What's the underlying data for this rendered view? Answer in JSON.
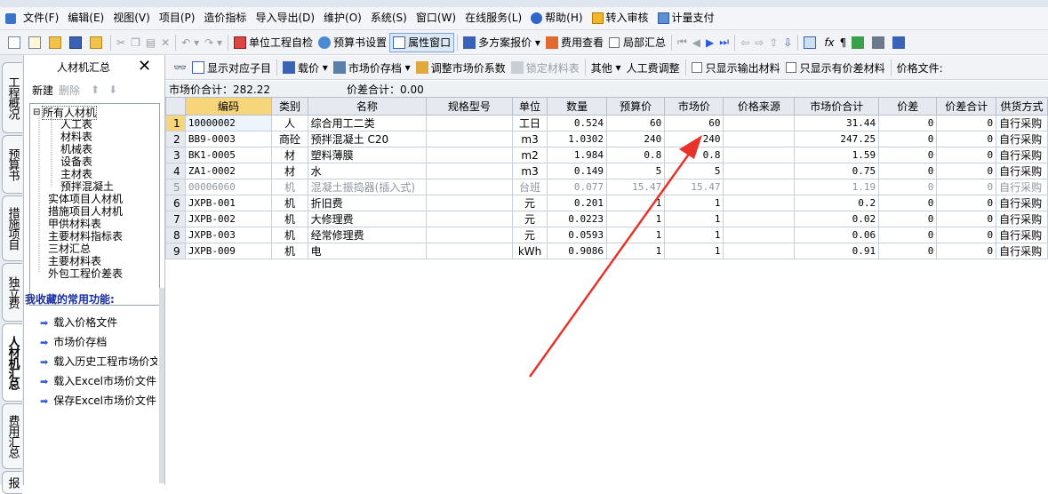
{
  "menu": [
    "文件(F)",
    "编辑(E)",
    "视图(V)",
    "项目(P)",
    "造价指标",
    "导入导出(D)",
    "维护(O)",
    "系统(S)",
    "窗口(W)",
    "在线服务(L)",
    "帮助(H)",
    "转入审核",
    "计量支付"
  ],
  "toolbar": {
    "unit_check": "单位工程自检",
    "budget_settings": "预算书设置",
    "property_window": "属性窗口",
    "multi_quote": "多方案报价",
    "fee_view": "费用查看",
    "partial_summary": "局部汇总"
  },
  "subtoolbar": {
    "show_children": "显示对应子目",
    "load_price": "载价",
    "market_archive": "市场价存档",
    "adjust_coef": "调整市场价系数",
    "lock_table": "锁定材料表",
    "other": "其他",
    "labor_adjust": "人工费调整",
    "only_output": "只显示输出材料",
    "only_diff": "只显示有价差材料",
    "price_file": "价格文件:"
  },
  "left_panel": {
    "title": "人材机汇总",
    "new_label": "新建",
    "delete_label": "删除",
    "tree": [
      "所有人材机",
      "人工表",
      "材料表",
      "机械表",
      "设备表",
      "主材表",
      "预拌混凝土",
      "实体项目人材机",
      "措施项目人材机",
      "甲供材料表",
      "主要材料指标表",
      "三材汇总",
      "主要材料表",
      "外包工程价差表"
    ],
    "fav_title": "我收藏的常用功能:",
    "favorites": [
      "载入价格文件",
      "市场价存档",
      "载入历史工程市场价文",
      "载入Excel市场价文件",
      "保存Excel市场价文件"
    ]
  },
  "side_tabs": [
    "工程概况",
    "预算书",
    "措施项目",
    "独立费",
    "人材机汇总",
    "费用汇总",
    "报"
  ],
  "summary": {
    "market_total": "市场价合计：282.22",
    "diff_total": "价差合计：0.00"
  },
  "table": {
    "headers": [
      "",
      "编码",
      "类别",
      "名称",
      "规格型号",
      "单位",
      "数量",
      "预算价",
      "市场价",
      "价格来源",
      "市场价合计",
      "价差",
      "价差合计",
      "供货方式"
    ],
    "rows": [
      [
        "1",
        "10000002",
        "人",
        "综合用工二类",
        "",
        "工日",
        "0.524",
        "60",
        "60",
        "",
        "31.44",
        "0",
        "0",
        "自行采购"
      ],
      [
        "2",
        "BB9-0003",
        "商砼",
        "预拌混凝土 C20",
        "",
        "m3",
        "1.0302",
        "240",
        "240",
        "",
        "247.25",
        "0",
        "0",
        "自行采购"
      ],
      [
        "3",
        "BK1-0005",
        "材",
        "塑料薄膜",
        "",
        "m2",
        "1.984",
        "0.8",
        "0.8",
        "",
        "1.59",
        "0",
        "0",
        "自行采购"
      ],
      [
        "4",
        "ZA1-0002",
        "材",
        "水",
        "",
        "m3",
        "0.149",
        "5",
        "5",
        "",
        "0.75",
        "0",
        "0",
        "自行采购"
      ],
      [
        "5",
        "00006060",
        "机",
        "混凝土振捣器(插入式)",
        "",
        "台班",
        "0.077",
        "15.47",
        "15.47",
        "",
        "1.19",
        "0",
        "0",
        "自行采购"
      ],
      [
        "6",
        "JXPB-001",
        "机",
        "折旧费",
        "",
        "元",
        "0.201",
        "1",
        "1",
        "",
        "0.2",
        "0",
        "0",
        "自行采购"
      ],
      [
        "7",
        "JXPB-002",
        "机",
        "大修理费",
        "",
        "元",
        "0.0223",
        "1",
        "1",
        "",
        "0.02",
        "0",
        "0",
        "自行采购"
      ],
      [
        "8",
        "JXPB-003",
        "机",
        "经常修理费",
        "",
        "元",
        "0.0593",
        "1",
        "1",
        "",
        "0.06",
        "0",
        "0",
        "自行采购"
      ],
      [
        "9",
        "JXPB-009",
        "机",
        "电",
        "",
        "kWh",
        "0.9086",
        "1",
        "1",
        "",
        "0.91",
        "0",
        "0",
        "自行采购"
      ]
    ]
  },
  "colors": {
    "arrow": "#e8332a",
    "header_highlight": "#f7d57a",
    "accent": "#1a2fa0"
  }
}
